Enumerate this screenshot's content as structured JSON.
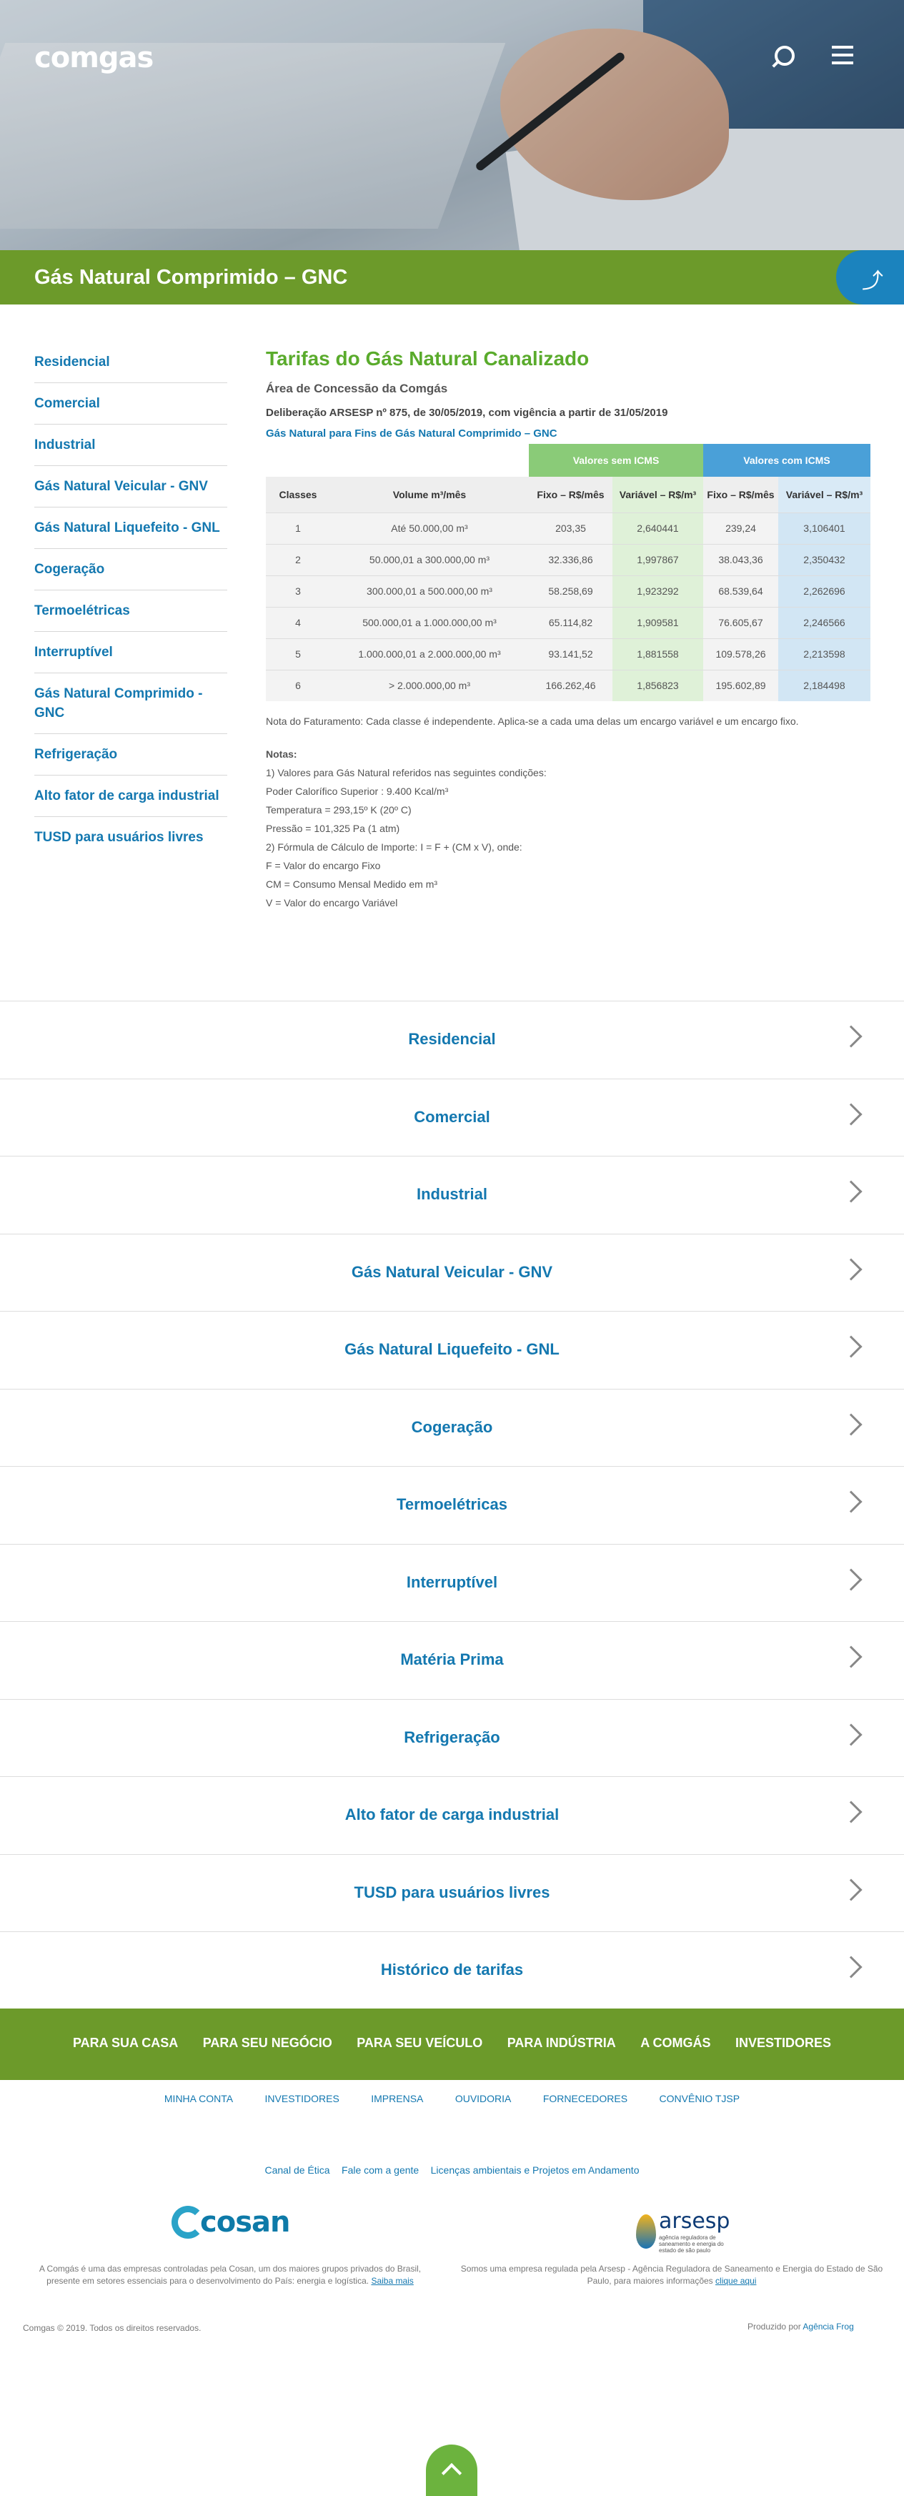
{
  "header": {
    "logo": "comgas",
    "search_icon": "search-icon",
    "menu_icon": "menu-icon"
  },
  "page_title": "Gás Natural Comprimido – GNC",
  "sidebar": {
    "items": [
      {
        "label": "Residencial"
      },
      {
        "label": "Comercial"
      },
      {
        "label": "Industrial"
      },
      {
        "label": "Gás Natural Veicular - GNV"
      },
      {
        "label": "Gás Natural Liquefeito - GNL"
      },
      {
        "label": "Cogeração"
      },
      {
        "label": "Termoelétricas"
      },
      {
        "label": "Interruptível"
      },
      {
        "label": "Gás Natural Comprimido - GNC"
      },
      {
        "label": "Refrigeração"
      },
      {
        "label": "Alto fator de carga industrial"
      },
      {
        "label": "TUSD para usuários livres"
      }
    ]
  },
  "content": {
    "heading": "Tarifas do Gás Natural Canalizado",
    "area": "Área de Concessão da Comgás",
    "deliberation": "Deliberação ARSESP nº 875, de 30/05/2019, com vigência a partir de 31/05/2019",
    "subtitle": "Gás Natural para Fins de Gás Natural Comprimido – GNC",
    "table": {
      "group_sem": "Valores sem ICMS",
      "group_com": "Valores com ICMS",
      "headers": [
        "Classes",
        "Volume m³/mês",
        "Fixo – R$/mês",
        "Variável – R$/m³",
        "Fixo – R$/mês",
        "Variável – R$/m³"
      ],
      "rows": [
        [
          "1",
          "Até 50.000,00 m³",
          "203,35",
          "2,640441",
          "239,24",
          "3,106401"
        ],
        [
          "2",
          "50.000,01 a 300.000,00 m³",
          "32.336,86",
          "1,997867",
          "38.043,36",
          "2,350432"
        ],
        [
          "3",
          "300.000,01 a 500.000,00 m³",
          "58.258,69",
          "1,923292",
          "68.539,64",
          "2,262696"
        ],
        [
          "4",
          "500.000,01 a 1.000.000,00 m³",
          "65.114,82",
          "1,909581",
          "76.605,67",
          "2,246566"
        ],
        [
          "5",
          "1.000.000,01 a 2.000.000,00 m³",
          "93.141,52",
          "1,881558",
          "109.578,26",
          "2,213598"
        ],
        [
          "6",
          "> 2.000.000,00 m³",
          "166.262,46",
          "1,856823",
          "195.602,89",
          "2,184498"
        ]
      ]
    },
    "billing_note": "Nota do Faturamento: Cada classe é independente. Aplica-se a cada uma delas um encargo variável e um encargo fixo.",
    "notes_title": "Notas:",
    "notes": [
      "1) Valores para Gás Natural referidos nas seguintes condições:",
      "Poder Calorífico Superior : 9.400 Kcal/m³",
      "Temperatura = 293,15º K (20º C)",
      "Pressão = 101,325 Pa (1 atm)",
      "2) Fórmula de Cálculo de Importe: I = F + (CM x V), onde:",
      "F = Valor do encargo Fixo",
      "CM = Consumo Mensal Medido em m³",
      "V = Valor do encargo Variável"
    ]
  },
  "accordion": [
    {
      "label": "Residencial"
    },
    {
      "label": "Comercial"
    },
    {
      "label": "Industrial"
    },
    {
      "label": "Gás Natural Veicular - GNV"
    },
    {
      "label": "Gás Natural Liquefeito - GNL"
    },
    {
      "label": "Cogeração"
    },
    {
      "label": "Termoelétricas"
    },
    {
      "label": "Interruptível"
    },
    {
      "label": "Matéria Prima"
    },
    {
      "label": "Refrigeração"
    },
    {
      "label": "Alto fator de carga industrial"
    },
    {
      "label": "TUSD para usuários livres"
    },
    {
      "label": "Histórico de tarifas"
    }
  ],
  "footer": {
    "nav": [
      "PARA SUA CASA",
      "PARA SEU NEGÓCIO",
      "PARA SEU VEÍCULO",
      "PARA INDÚSTRIA",
      "A COMGÁS",
      "INVESTIDORES"
    ],
    "sublinks": [
      "MINHA CONTA",
      "INVESTIDORES",
      "IMPRENSA",
      "OUVIDORIA",
      "FORNECEDORES",
      "CONVÊNIO TJSP"
    ],
    "ethics": [
      "Canal de Ética",
      "Fale com a gente",
      "Licenças ambientais e Projetos em Andamento"
    ],
    "cosan_logo": "cosan",
    "cosan_text": "A Comgás é uma das empresas controladas pela Cosan, um dos maiores grupos privados do Brasil, presente em setores essenciais para o desenvolvimento do País: energia e logística.",
    "cosan_link": "Saiba mais",
    "arsesp_logo": "arsesp",
    "arsesp_tagline": "agência reguladora de saneamento e energia do estado de são paulo",
    "arsesp_text": "Somos uma empresa regulada pela Arsesp - Agência Reguladora de Saneamento e Energia do Estado de São Paulo, para maiores informações",
    "arsesp_link": "clique aqui",
    "copyright": "Comgas © 2019. Todos os direitos reservados.",
    "produced_by": "Produzido por",
    "producer": "Agência Frog"
  },
  "colors": {
    "brand_green": "#6c9a2a",
    "link_blue": "#1478b0",
    "heading_green": "#5aab2c"
  }
}
